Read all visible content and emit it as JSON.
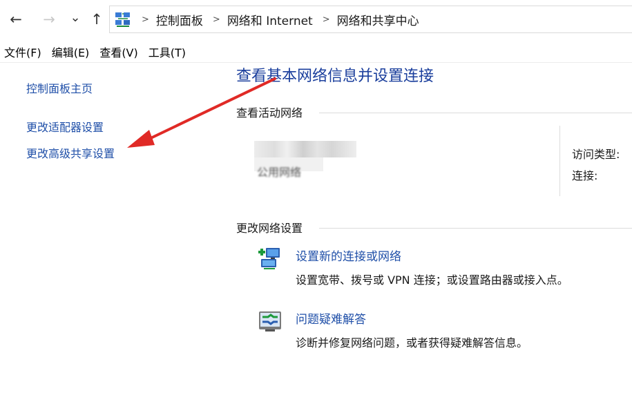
{
  "nav": {
    "back_icon": "arrow-left-icon",
    "forward_icon": "arrow-right-icon",
    "recent_icon": "chevron-down-icon",
    "up_icon": "arrow-up-icon",
    "back_glyph": "←",
    "forward_glyph": "→",
    "recent_glyph": "⌄",
    "up_glyph": "↑"
  },
  "breadcrumb": {
    "items": [
      "控制面板",
      "网络和 Internet",
      "网络和共享中心"
    ],
    "separator": ">"
  },
  "menu": {
    "items": [
      "文件(F)",
      "编辑(E)",
      "查看(V)",
      "工具(T)"
    ]
  },
  "sidebar": {
    "links": [
      "控制面板主页",
      "更改适配器设置",
      "更改高级共享设置"
    ]
  },
  "main": {
    "title": "查看基本网络信息并设置连接",
    "active_section": "查看活动网络",
    "network_type": "公用网络",
    "access_type_label": "访问类型:",
    "connection_label": "连接:",
    "change_section": "更改网络设置",
    "tasks": [
      {
        "link": "设置新的连接或网络",
        "desc": "设置宽带、拨号或 VPN 连接；或设置路由器或接入点。",
        "icon": "new-connection-icon"
      },
      {
        "link": "问题疑难解答",
        "desc": "诊断并修复网络问题，或者获得疑难解答信息。",
        "icon": "troubleshoot-icon"
      }
    ]
  },
  "colors": {
    "link": "#1f4fa8",
    "title": "#1a3e9c",
    "annotation_arrow": "#e02a26"
  }
}
